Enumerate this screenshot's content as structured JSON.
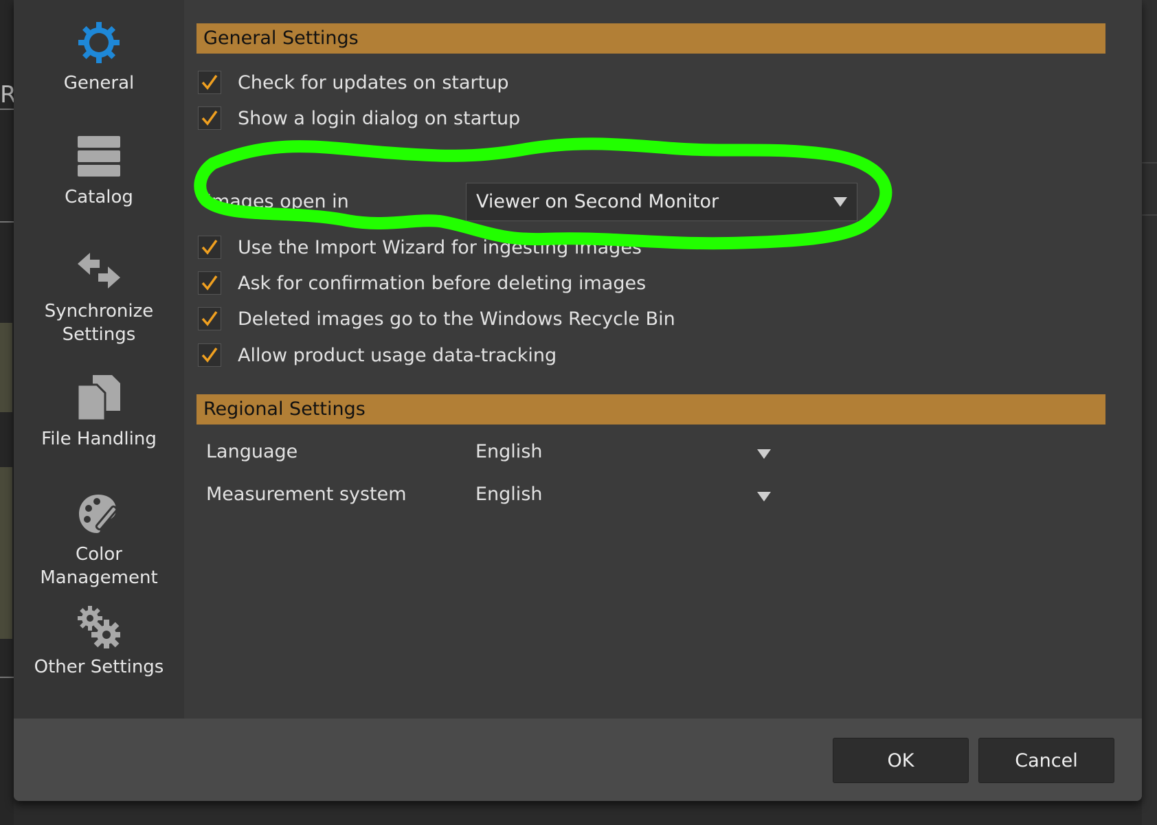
{
  "sidebar": {
    "items": [
      {
        "label": "General",
        "icon": "gear-icon"
      },
      {
        "label": "Catalog",
        "icon": "catalog-stack-icon"
      },
      {
        "label_line1": "Synchronize",
        "label_line2": "Settings",
        "icon": "sync-arrows-icon"
      },
      {
        "label": "File Handling",
        "icon": "file-copy-icon"
      },
      {
        "label_line1": "Color",
        "label_line2": "Management",
        "icon": "palette-icon"
      },
      {
        "label": "Other Settings",
        "icon": "gears-icon"
      }
    ]
  },
  "general": {
    "header": "General Settings",
    "check_updates": "Check for updates on startup",
    "login_dialog": "Show a login dialog on startup",
    "images_open_label": "Images open in",
    "images_open_value": "Viewer on Second Monitor",
    "import_wizard": "Use the Import Wizard for ingesting images",
    "confirm_delete": "Ask for confirmation before deleting images",
    "recycle_bin": "Deleted images go to the Windows Recycle Bin",
    "usage_tracking": "Allow product usage data-tracking"
  },
  "regional": {
    "header": "Regional Settings",
    "language_label": "Language",
    "language_value": "English",
    "measurement_label": "Measurement system",
    "measurement_value": "English"
  },
  "footer": {
    "ok": "OK",
    "cancel": "Cancel"
  },
  "colors": {
    "accent_blue": "#1e88d8",
    "header_orange": "#b27f36",
    "check_orange": "#f0a020",
    "highlight_green": "#22ff00"
  },
  "background": {
    "left_letter": "R"
  }
}
